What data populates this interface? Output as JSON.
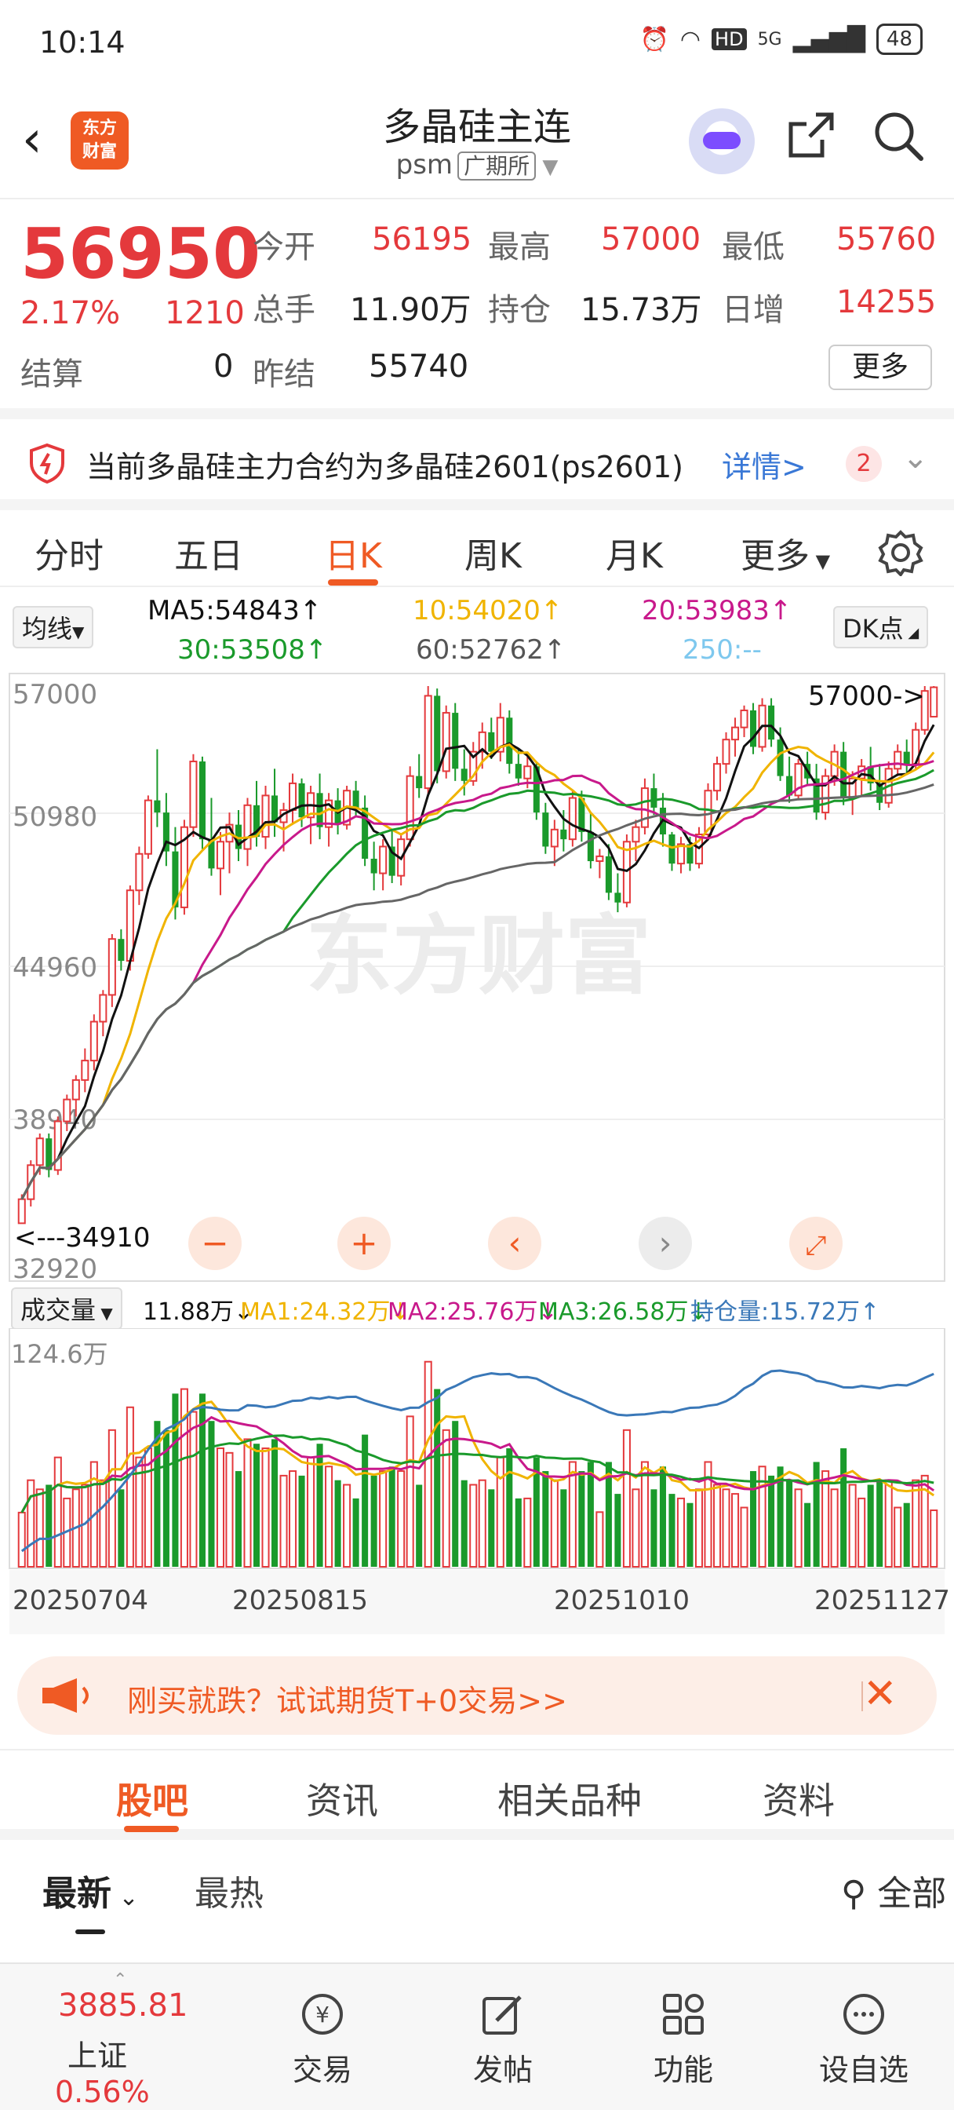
{
  "status_bar": {
    "time": "10:14",
    "network": "5G",
    "hd": "HD",
    "battery": "48"
  },
  "header": {
    "title": "多晶硅主连",
    "code": "psm",
    "exchange": "广期所",
    "logo_text": "东方财富"
  },
  "quote": {
    "price": "56950",
    "change_pct": "2.17%",
    "change": "1210",
    "open_label": "今开",
    "open": "56195",
    "high_label": "最高",
    "high": "57000",
    "low_label": "最低",
    "low": "55760",
    "volume_label": "总手",
    "volume": "11.90万",
    "oi_label": "持仓",
    "oi": "15.73万",
    "daily_inc_label": "日增",
    "daily_inc": "14255",
    "settle_label": "结算",
    "settle": "0",
    "prev_settle_label": "昨结",
    "prev_settle": "55740",
    "more_label": "更多"
  },
  "notice": {
    "text": "当前多晶硅主力合约为多晶硅2601(ps2601)",
    "link": "详情>",
    "badge": "2"
  },
  "kline_tabs": [
    "分时",
    "五日",
    "日K",
    "周K",
    "月K",
    "更多"
  ],
  "kline_active_tab": "日K",
  "ma_legend": {
    "selector": "均线",
    "ma5": "MA5:54843↑",
    "ma10": "10:54020↑",
    "ma20": "20:53983↑",
    "ma30": "30:53508↑",
    "ma60": "60:52762↑",
    "ma250": "250:--",
    "dk_label": "DK点"
  },
  "chart_data": [
    {
      "type": "candlestick",
      "title": "",
      "y_ticks": [
        "57000",
        "50980",
        "44960",
        "38940",
        "32920"
      ],
      "ylim": [
        32920,
        57000
      ],
      "max_marker": "57000->",
      "min_marker": "<---34910",
      "watermark": "东方财富",
      "candles": [
        [
          34910,
          36100,
          34910,
          35900
        ],
        [
          35900,
          37500,
          35600,
          37300
        ],
        [
          37300,
          38600,
          36900,
          38400
        ],
        [
          38400,
          38600,
          36800,
          37100
        ],
        [
          37100,
          39300,
          36900,
          39100
        ],
        [
          39100,
          40200,
          38700,
          40000
        ],
        [
          40000,
          41000,
          39300,
          40800
        ],
        [
          40800,
          42100,
          40300,
          41600
        ],
        [
          41600,
          43500,
          41200,
          43200
        ],
        [
          43200,
          44500,
          42600,
          44300
        ],
        [
          44300,
          46800,
          43800,
          46600
        ],
        [
          46600,
          47000,
          45300,
          45700
        ],
        [
          45700,
          48800,
          45300,
          48600
        ],
        [
          48600,
          50400,
          48000,
          50100
        ],
        [
          50100,
          52500,
          49900,
          52300
        ],
        [
          52300,
          54400,
          51200,
          51800
        ],
        [
          51800,
          52600,
          49600,
          50200
        ],
        [
          50200,
          51200,
          47400,
          47900
        ],
        [
          47900,
          51500,
          47600,
          51200
        ],
        [
          51200,
          54200,
          50800,
          53900
        ],
        [
          53900,
          54100,
          50300,
          50700
        ],
        [
          50700,
          52400,
          49200,
          49500
        ],
        [
          49500,
          51000,
          48400,
          50600
        ],
        [
          50600,
          51800,
          49300,
          51300
        ],
        [
          51300,
          51900,
          49800,
          50300
        ],
        [
          50300,
          52400,
          49600,
          52100
        ],
        [
          52100,
          53100,
          50400,
          50800
        ],
        [
          50800,
          52900,
          50300,
          52500
        ],
        [
          52500,
          53600,
          50800,
          51400
        ],
        [
          51400,
          52200,
          50200,
          51900
        ],
        [
          51900,
          53400,
          51300,
          53000
        ],
        [
          53000,
          53200,
          51200,
          51600
        ],
        [
          51600,
          52900,
          50500,
          52600
        ],
        [
          52600,
          53400,
          50700,
          51200
        ],
        [
          51200,
          52600,
          50400,
          52300
        ],
        [
          52300,
          52800,
          50900,
          51300
        ],
        [
          51300,
          52900,
          51100,
          52700
        ],
        [
          52700,
          53100,
          51600,
          52000
        ],
        [
          52000,
          52500,
          49600,
          49900
        ],
        [
          49900,
          50600,
          48600,
          49300
        ],
        [
          49300,
          50700,
          48600,
          50400
        ],
        [
          50400,
          51100,
          48900,
          49200
        ],
        [
          49200,
          50900,
          48800,
          50700
        ],
        [
          50700,
          53700,
          50400,
          53300
        ],
        [
          53300,
          54200,
          52400,
          52800
        ],
        [
          52800,
          57000,
          52500,
          56600
        ],
        [
          56600,
          56900,
          53000,
          53500
        ],
        [
          53500,
          56200,
          53200,
          55900
        ],
        [
          55900,
          56300,
          53100,
          53600
        ],
        [
          53600,
          54400,
          52500,
          53100
        ],
        [
          53100,
          54700,
          52900,
          54300
        ],
        [
          54300,
          55500,
          53600,
          55100
        ],
        [
          55100,
          55700,
          54000,
          54300
        ],
        [
          54300,
          56300,
          53900,
          55700
        ],
        [
          55700,
          56000,
          53400,
          53800
        ],
        [
          53800,
          54400,
          52900,
          53200
        ],
        [
          53200,
          54300,
          52800,
          53700
        ],
        [
          53700,
          53900,
          51500,
          51800
        ],
        [
          51800,
          52200,
          50100,
          50400
        ],
        [
          50400,
          51500,
          49600,
          51100
        ],
        [
          51100,
          51900,
          50200,
          50700
        ],
        [
          50700,
          52700,
          50400,
          52400
        ],
        [
          52400,
          52700,
          50600,
          51000
        ],
        [
          51000,
          51800,
          49500,
          49800
        ],
        [
          49800,
          50300,
          49100,
          50000
        ],
        [
          50000,
          50500,
          48200,
          48500
        ],
        [
          48500,
          49300,
          47700,
          48100
        ],
        [
          48100,
          50900,
          47900,
          50600
        ],
        [
          50600,
          51500,
          49800,
          51200
        ],
        [
          51200,
          53200,
          50900,
          52800
        ],
        [
          52800,
          53400,
          51700,
          52000
        ],
        [
          52000,
          52600,
          50400,
          50900
        ],
        [
          50900,
          51000,
          49400,
          49700
        ],
        [
          49700,
          50800,
          49300,
          50500
        ],
        [
          50500,
          50800,
          49400,
          49700
        ],
        [
          49700,
          51200,
          49500,
          50900
        ],
        [
          50900,
          53000,
          50700,
          52700
        ],
        [
          52700,
          54100,
          52300,
          53800
        ],
        [
          53800,
          55100,
          53400,
          54800
        ],
        [
          54800,
          55700,
          54100,
          55300
        ],
        [
          55300,
          56200,
          54900,
          56000
        ],
        [
          56000,
          56300,
          54200,
          54500
        ],
        [
          54500,
          56500,
          54300,
          56200
        ],
        [
          56200,
          56500,
          54500,
          54800
        ],
        [
          54800,
          55300,
          53100,
          53300
        ],
        [
          53300,
          54100,
          52200,
          52500
        ],
        [
          52500,
          54000,
          52300,
          53800
        ],
        [
          53800,
          54300,
          52900,
          53200
        ],
        [
          53200,
          53800,
          51500,
          51800
        ],
        [
          51800,
          53600,
          51500,
          53300
        ],
        [
          53300,
          54600,
          52900,
          54300
        ],
        [
          54300,
          54700,
          52100,
          52400
        ],
        [
          52400,
          53500,
          51700,
          53200
        ],
        [
          53200,
          54000,
          52500,
          53700
        ],
        [
          53700,
          54500,
          52700,
          53000
        ],
        [
          53000,
          53800,
          51900,
          52200
        ],
        [
          52200,
          53900,
          52000,
          53600
        ],
        [
          53600,
          54600,
          53300,
          54300
        ],
        [
          54300,
          54800,
          53400,
          53800
        ],
        [
          53800,
          55500,
          53600,
          55200
        ],
        [
          55200,
          57000,
          55000,
          56800
        ],
        [
          55740,
          57000,
          55760,
          56950
        ]
      ],
      "ma_lines": [
        "MA5",
        "MA10",
        "MA20",
        "MA30",
        "MA60"
      ]
    },
    {
      "type": "bar",
      "title": "成交量",
      "y_tick": "124.6万",
      "x_labels": [
        "20250704",
        "20250815",
        "20251010",
        "20251127"
      ],
      "latest_volume": "11.88万↓",
      "MA1": "MA1:24.32万↓",
      "MA2": "MA2:25.76万↓",
      "MA3": "MA3:26.58万↓",
      "open_interest": "持仓量:15.72万↑"
    }
  ],
  "ad": {
    "text": "刚买就跌？试试期货T+0交易>>"
  },
  "content_tabs": [
    "股吧",
    "资讯",
    "相关品种",
    "资料"
  ],
  "content_active_tab": "股吧",
  "sort": {
    "latest": "最新",
    "hot": "最热",
    "filter": "全部"
  },
  "bottom_nav": {
    "index_value": "3885.81",
    "index_name": "上证",
    "index_change": "0.56%",
    "items": [
      "交易",
      "发帖",
      "功能",
      "设自选"
    ]
  },
  "colors": {
    "up": "#e4393c",
    "down": "#1a9a2b",
    "accent": "#ef5a24",
    "ma5": "#111111",
    "ma10": "#f0b400",
    "ma20": "#c8198b",
    "ma30": "#1a9a2b",
    "ma60": "#666666",
    "oi": "#3a78b8"
  }
}
